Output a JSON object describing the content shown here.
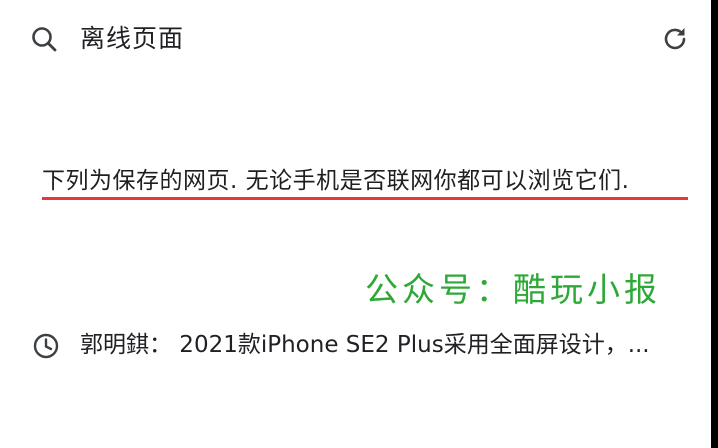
{
  "header": {
    "search_icon": "search-icon",
    "title": "离线页面",
    "refresh_icon": "refresh-icon"
  },
  "info": {
    "text": "下列为保存的网页. 无论手机是否联网你都可以浏览它们."
  },
  "watermark": {
    "text": "公众号：酷玩小报"
  },
  "history": [
    {
      "icon": "clock-icon",
      "title": "郭明錤： 2021款iPhone SE2 Plus采用全面屏设计，..."
    }
  ],
  "colors": {
    "underline": "#e53935",
    "watermark": "#2ea836",
    "text": "#202124",
    "background": "#ffffff"
  }
}
